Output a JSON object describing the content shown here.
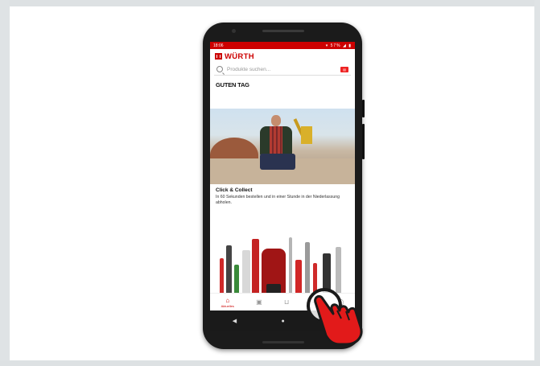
{
  "statusbar": {
    "time": "18:06",
    "icons": "▾ 57% ◢ ▮"
  },
  "brand": {
    "name": "WÜRTH"
  },
  "search": {
    "placeholder": "Produkte suchen..."
  },
  "greeting": "GUTEN TAG",
  "promo": {
    "title": "Click & Collect",
    "text": "In 60 Sekunden bestellen und in einer Stunde in der Niederlassung abholen."
  },
  "bottom_nav": [
    {
      "label": "Aktuelles",
      "icon": "home-icon",
      "active": true
    },
    {
      "label": "",
      "icon": "catalog-icon",
      "active": false
    },
    {
      "label": "",
      "icon": "cart-icon",
      "active": false
    },
    {
      "label": "",
      "icon": "menu-icon",
      "active": false
    },
    {
      "label": "",
      "icon": "profile-icon",
      "active": false
    }
  ],
  "android_nav": {
    "back": "◀",
    "home": "●",
    "recents": "■"
  },
  "colors": {
    "brand_red": "#cc0000",
    "phone_body": "#1b1b1b",
    "hand_red": "#e21a1a"
  }
}
